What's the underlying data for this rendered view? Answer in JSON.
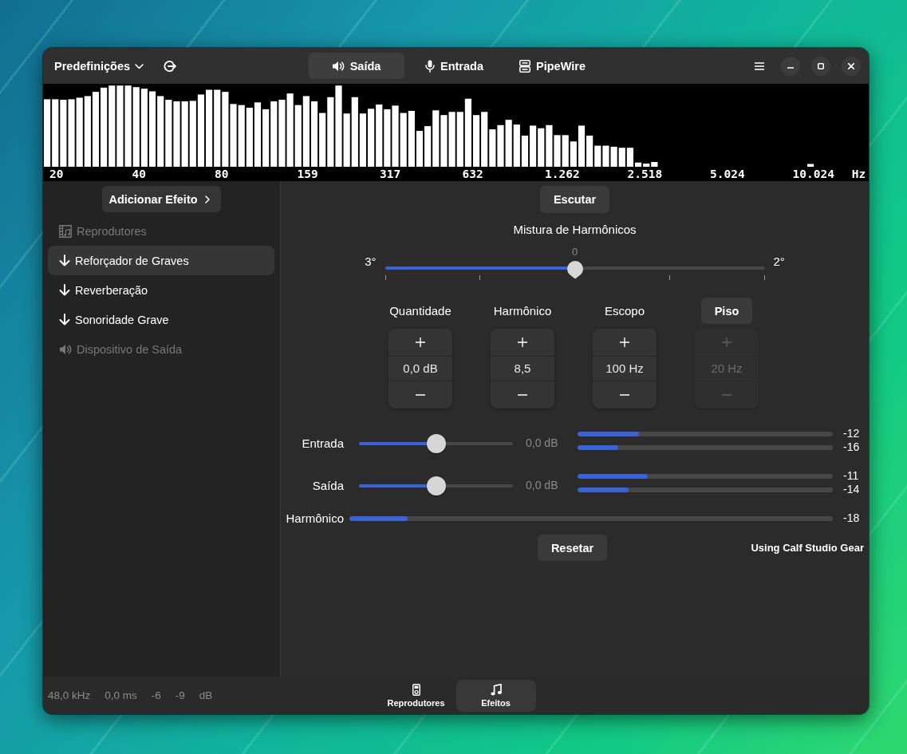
{
  "header": {
    "presets_menu": "Predefinições",
    "tabs": [
      {
        "kind": "output",
        "label": "Saída",
        "selected": true
      },
      {
        "kind": "input",
        "label": "Entrada",
        "selected": false
      },
      {
        "kind": "server",
        "label": "PipeWire",
        "selected": false
      }
    ]
  },
  "spectrum": {
    "frequency_labels": [
      "20",
      "40",
      "80",
      "159",
      "317",
      "632",
      "1.262",
      "2.518",
      "5.024",
      "10.024"
    ],
    "unit": "Hz"
  },
  "sidebar": {
    "add_button": "Adicionar Efeito",
    "items": [
      {
        "kind": "source",
        "label": "Reprodutores",
        "selected": false
      },
      {
        "kind": "effect",
        "label": "Reforçador de Graves",
        "selected": true
      },
      {
        "kind": "effect",
        "label": "Reverberação",
        "selected": false
      },
      {
        "kind": "effect",
        "label": "Sonoridade Grave",
        "selected": false
      },
      {
        "kind": "sink",
        "label": "Dispositivo de Saída",
        "selected": false
      }
    ]
  },
  "effect": {
    "listen_button": "Escutar",
    "mix": {
      "title": "Mistura de Harmônicos",
      "value": "0",
      "min_label": "3°",
      "max_label": "2°",
      "level": 0.5
    },
    "controls": [
      {
        "kind": "spin",
        "label": "Quantidade",
        "value": "0,0 dB",
        "disabled": false
      },
      {
        "kind": "spin",
        "label": "Harmônico",
        "value": "8,5",
        "disabled": false
      },
      {
        "kind": "spin",
        "label": "Escopo",
        "value": "100 Hz",
        "disabled": false
      },
      {
        "kind": "toggle",
        "label": "Piso",
        "value": "20 Hz",
        "disabled": true
      }
    ],
    "gains": [
      {
        "label": "Entrada",
        "level": 0.5,
        "reading": "0,0 dB",
        "meters": [
          {
            "level": 0.24,
            "reading": "-12"
          },
          {
            "level": 0.16,
            "reading": "-16"
          }
        ]
      },
      {
        "label": "Saída",
        "level": 0.5,
        "reading": "0,0 dB",
        "meters": [
          {
            "level": 0.275,
            "reading": "-11"
          },
          {
            "level": 0.2,
            "reading": "-14"
          }
        ]
      }
    ],
    "harmonics_meter": {
      "label": "Harmônico",
      "level": 0.12,
      "reading": "-18"
    },
    "reset_button": "Resetar",
    "credit": "Using Calf Studio Gear"
  },
  "status_bar": {
    "items": [
      "48,0 kHz",
      "0,0 ms",
      "-6",
      "-9",
      "dB"
    ],
    "views": [
      {
        "kind": "players",
        "label": "Reprodutores",
        "selected": false
      },
      {
        "kind": "effects",
        "label": "Efeitos",
        "selected": true
      }
    ]
  }
}
